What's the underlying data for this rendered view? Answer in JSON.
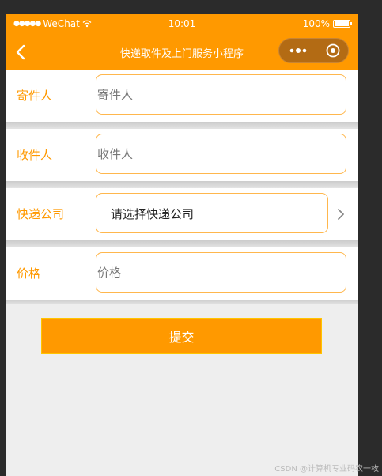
{
  "status_bar": {
    "signal": "●●●●●",
    "carrier": "WeChat",
    "time": "10:01",
    "battery": "100%"
  },
  "nav": {
    "title": "快递取件及上门服务小程序"
  },
  "form": {
    "sender": {
      "label": "寄件人",
      "placeholder": "寄件人"
    },
    "receiver": {
      "label": "收件人",
      "placeholder": "收件人"
    },
    "courier": {
      "label": "快递公司",
      "value": "请选择快递公司"
    },
    "price": {
      "label": "价格",
      "placeholder": "价格"
    }
  },
  "submit_label": "提交",
  "watermark": "CSDN @计算机专业码农一枚",
  "colors": {
    "accent": "#ff9900",
    "input_border": "#ffb74d",
    "background": "#eeeeee"
  }
}
